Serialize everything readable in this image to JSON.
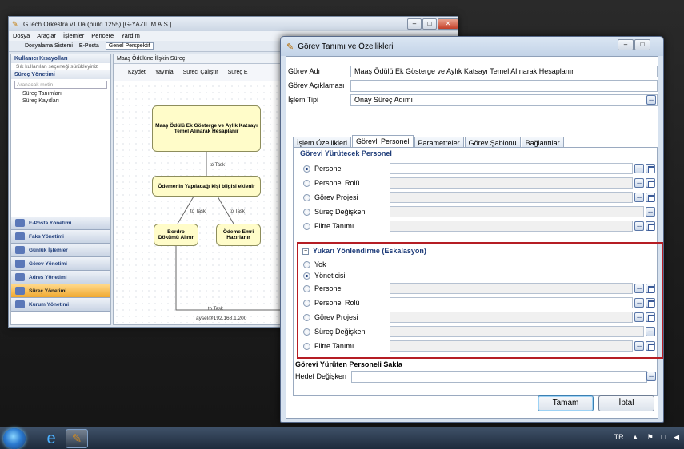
{
  "background_app": {
    "title": "GTech Orkestra v1.0a (build 1255) [G-YAZILIM A.S.]",
    "menu": [
      "Dosya",
      "Araçlar",
      "İşlemler",
      "Pencere",
      "Yardım"
    ],
    "toolbar": [
      "Dosyalama Sistemi",
      "E-Posta",
      "Genel Perspektif"
    ],
    "left": {
      "section1": "Kullanıcı Kısayolları",
      "section1_text": "Sık kullanılan seçeneği sürükleyiniz",
      "section2": "Süreç Yönetimi",
      "search_placeholder": "Aranacak metin",
      "tree": [
        "Süreç Tanımları",
        "Süreç Kayıtları"
      ],
      "nav": [
        "E-Posta Yönetimi",
        "Faks Yönetimi",
        "Günlük İşlemler",
        "Görev Yönetimi",
        "Adres Yönetimi",
        "Süreç Yönetimi",
        "Kurum Yönetimi"
      ]
    },
    "editor": {
      "tab": "Maaş Ödülüne İlişkin Süreç",
      "tools": [
        "Kaydet",
        "Yayınla",
        "Süreci Çalıştır",
        "Süreç E"
      ],
      "nodes": [
        "Maaş Ödülü Ek Gösterge ve Aylık Katsayı Temel Alınarak Hesaplanır",
        "Ödemenin Yapılacağı kişi bilgisi eklenir",
        "Bordro Dökümü Alınır",
        "Ödeme Emri Hazırlanır"
      ],
      "edge_label": "to Task"
    },
    "status": "aysel@192.168.1.200"
  },
  "dialog": {
    "title": "Görev Tanımı ve Özellikleri",
    "fields": {
      "gorev_adi_label": "Görev Adı",
      "gorev_adi_value": "Maaş Ödülü Ek Gösterge ve Aylık Katsayı Temel Alınarak Hesaplanır",
      "gorev_aciklamasi_label": "Görev Açıklaması",
      "gorev_aciklamasi_value": "",
      "islem_tipi_label": "İşlem Tipi",
      "islem_tipi_value": "Onay Süreç Adımı"
    },
    "tabs": [
      "İşlem Özellikleri",
      "Görevli Personel",
      "Parametreler",
      "Görev Şablonu",
      "Bağlantılar"
    ],
    "active_tab": "Görevli Personel",
    "section_executor": {
      "title": "Görevi Yürütecek Personel",
      "options": [
        "Personel",
        "Personel Rolü",
        "Görev Projesi",
        "Süreç Değişkeni",
        "Filtre Tanımı"
      ],
      "selected": "Personel"
    },
    "section_escalation": {
      "title": "Yukarı Yönlendirme (Eskalasyon)",
      "options": [
        "Yok",
        "Yöneticisi",
        "Personel",
        "Personel Rolü",
        "Görev Projesi",
        "Süreç Değişkeni",
        "Filtre Tanımı"
      ],
      "selected": "Yöneticisi"
    },
    "section_store": {
      "title": "Görevi Yürüten Personeli Sakla",
      "label": "Hedef Değişken",
      "value": ""
    },
    "ok": "Tamam",
    "cancel": "İptal",
    "ellipsis": "..."
  },
  "taskbar": {
    "tray": [
      "TR",
      "▲",
      "⚑",
      "□",
      "◀"
    ]
  }
}
